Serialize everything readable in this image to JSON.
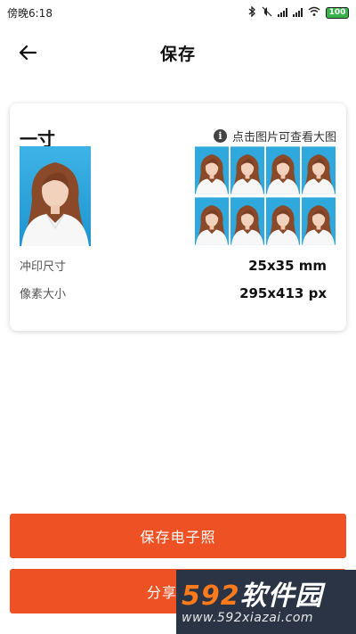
{
  "status_bar": {
    "time": "傍晚6:18",
    "battery": "100"
  },
  "header": {
    "title": "保存"
  },
  "card": {
    "size_name": "一寸",
    "hint": "点击图片可查看大图",
    "specs": [
      {
        "label": "冲印尺寸",
        "value": "25x35 mm"
      },
      {
        "label": "像素大小",
        "value": "295x413 px"
      }
    ]
  },
  "buttons": {
    "save": "保存电子照",
    "share": "分享"
  },
  "watermark": {
    "brand_num": "592",
    "brand_text": "软件园",
    "url": "www.592xiazai.com"
  },
  "colors": {
    "accent": "#ee5224",
    "photo_bg": "#2fa8de"
  }
}
